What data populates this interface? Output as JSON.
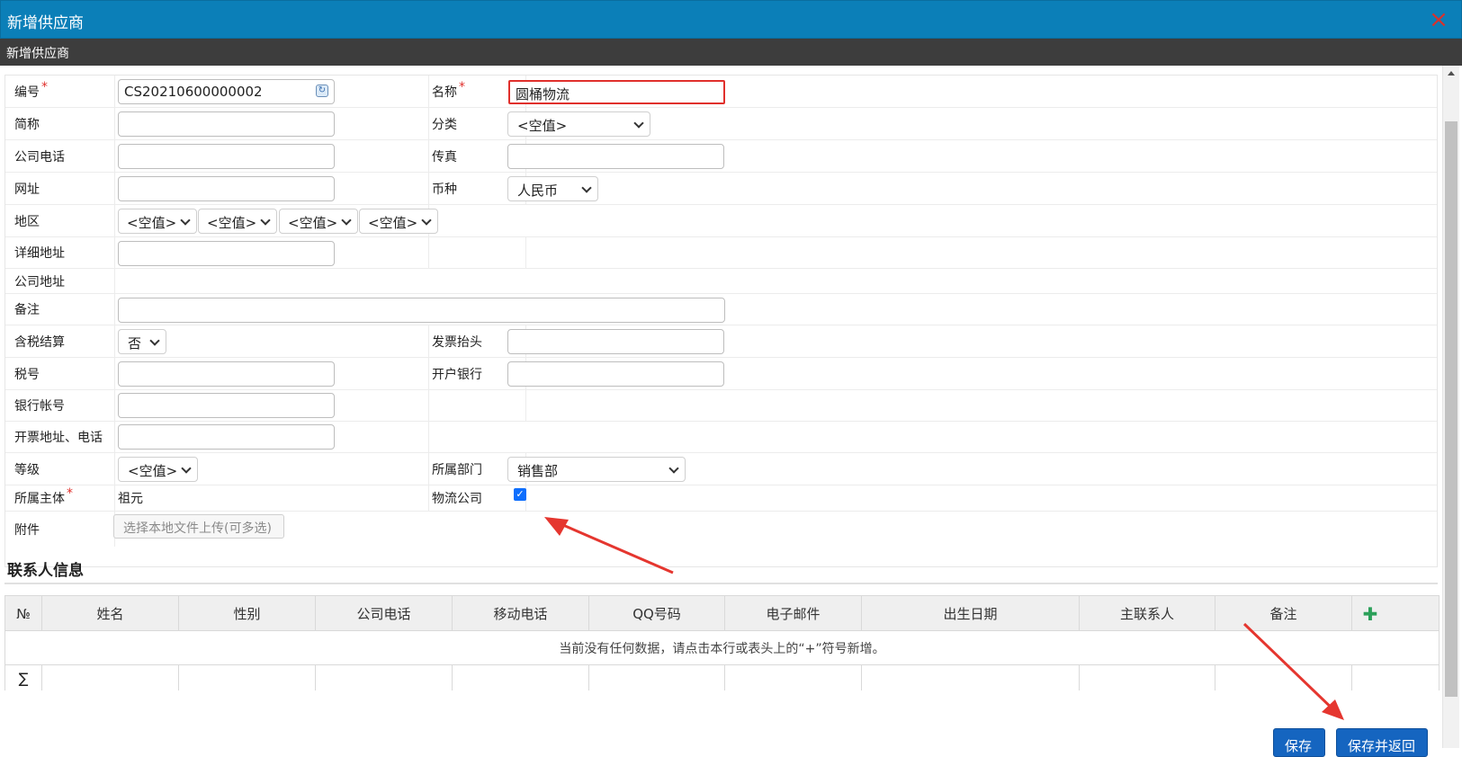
{
  "window": {
    "title": "新增供应商",
    "close_icon": "×"
  },
  "subheader": {
    "title": "新增供应商"
  },
  "form": {
    "code": {
      "label": "编号",
      "required": "*",
      "value": "CS20210600000002"
    },
    "name": {
      "label": "名称",
      "required": "*",
      "value": "圆桶物流"
    },
    "short_name": {
      "label": "简称",
      "value": ""
    },
    "category": {
      "label": "分类",
      "value": "<空值>"
    },
    "phone": {
      "label": "公司电话",
      "value": ""
    },
    "fax": {
      "label": "传真",
      "value": ""
    },
    "website": {
      "label": "网址",
      "value": ""
    },
    "currency": {
      "label": "币种",
      "value": "人民币"
    },
    "region": {
      "label": "地区",
      "values": [
        "<空值>",
        "<空值>",
        "<空值>",
        "<空值>"
      ]
    },
    "detail_address": {
      "label": "详细地址",
      "value": ""
    },
    "company_address": {
      "label": "公司地址"
    },
    "remark": {
      "label": "备注",
      "value": ""
    },
    "tax_inclusive": {
      "label": "含税结算",
      "value": "否"
    },
    "invoice_title": {
      "label": "发票抬头",
      "value": ""
    },
    "tax_no": {
      "label": "税号",
      "value": ""
    },
    "bank": {
      "label": "开户银行",
      "value": ""
    },
    "bank_account": {
      "label": "银行帐号",
      "value": ""
    },
    "invoice_addr_phone": {
      "label": "开票地址、电话",
      "value": ""
    },
    "level": {
      "label": "等级",
      "value": "<空值>"
    },
    "department": {
      "label": "所属部门",
      "value": "销售部"
    },
    "entity": {
      "label": "所属主体",
      "required": "*",
      "value": "祖元"
    },
    "logistics_company": {
      "label": "物流公司",
      "checked": true
    },
    "attachment": {
      "label": "附件",
      "button": "选择本地文件上传(可多选)"
    }
  },
  "contacts": {
    "title": "联系人信息",
    "columns": [
      "№",
      "姓名",
      "性别",
      "公司电话",
      "移动电话",
      "QQ号码",
      "电子邮件",
      "出生日期",
      "主联系人",
      "备注"
    ],
    "empty_text": "当前没有任何数据，请点击本行或表头上的“+”符号新增。",
    "sum_symbol": "∑"
  },
  "buttons": {
    "save": "保存",
    "save_return": "保存并返回"
  },
  "colors": {
    "title_bar": "#0b7fb8",
    "sub_bar": "#3d3d3d",
    "required": "#e0302c",
    "highlight_border": "#e0302c",
    "primary_button": "#1565c0",
    "annotation_arrow": "#e5362f"
  }
}
